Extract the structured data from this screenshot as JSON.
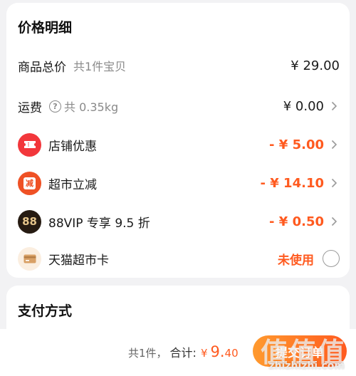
{
  "price_detail": {
    "title": "价格明细",
    "goods_total": {
      "label": "商品总价",
      "sub": "共1件宝贝",
      "amount": "¥ 29.00"
    },
    "shipping": {
      "label": "运费",
      "help_glyph": "?",
      "sub": "共 0.35kg",
      "amount": "¥ 0.00"
    },
    "shop_discount": {
      "label": "店铺优惠",
      "amount": "- ¥ 5.00",
      "icon": "ticket-icon"
    },
    "market_discount": {
      "label": "超市立减",
      "amount": "- ¥ 14.10",
      "icon_text": "减"
    },
    "vip_discount": {
      "label": "88VIP 专享 9.5 折",
      "amount": "- ¥ 0.50",
      "icon_text": "88"
    },
    "tmall_card": {
      "label": "天猫超市卡",
      "status": "未使用",
      "icon": "card-icon"
    }
  },
  "payment": {
    "title": "支付方式"
  },
  "footer": {
    "count": "共1件，",
    "total_label": "合计:",
    "currency": "¥",
    "total_int": "9.",
    "total_dec": "40",
    "submit": "提交订单"
  },
  "watermark": {
    "glyphs": "值值值",
    "text": "zhizhizhi.com"
  },
  "colors": {
    "accent": "#ff5a1f",
    "background": "#f2f2f4",
    "card": "#ffffff"
  }
}
